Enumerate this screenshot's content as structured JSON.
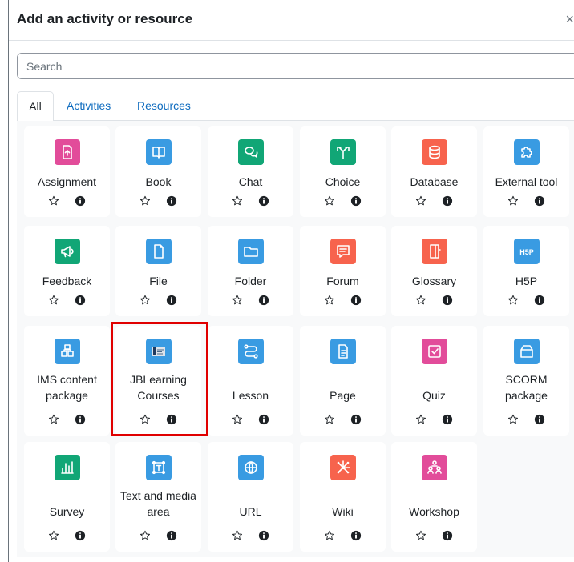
{
  "modal": {
    "title": "Add an activity or resource",
    "close": "×"
  },
  "search": {
    "placeholder": "Search"
  },
  "tabs": [
    "All",
    "Activities",
    "Resources"
  ],
  "colors": {
    "pink": "#e24c9a",
    "blue": "#399be2",
    "green": "#11a676",
    "red": "#f7634d",
    "link": "#0f6cbf",
    "highlight": "#e00000"
  },
  "items": [
    {
      "name": "Assignment",
      "lines": [
        "Assignment"
      ],
      "color": "#e24c9a",
      "icon": "assignment-icon"
    },
    {
      "name": "Book",
      "lines": [
        "Book"
      ],
      "color": "#399be2",
      "icon": "book-icon"
    },
    {
      "name": "Chat",
      "lines": [
        "Chat"
      ],
      "color": "#11a676",
      "icon": "chat-icon"
    },
    {
      "name": "Choice",
      "lines": [
        "Choice"
      ],
      "color": "#11a676",
      "icon": "choice-icon"
    },
    {
      "name": "Database",
      "lines": [
        "Database"
      ],
      "color": "#f7634d",
      "icon": "database-icon"
    },
    {
      "name": "External tool",
      "lines": [
        "External tool"
      ],
      "color": "#399be2",
      "icon": "puzzle-icon"
    },
    {
      "name": "Feedback",
      "lines": [
        "Feedback"
      ],
      "color": "#11a676",
      "icon": "megaphone-icon"
    },
    {
      "name": "File",
      "lines": [
        "File"
      ],
      "color": "#399be2",
      "icon": "file-icon"
    },
    {
      "name": "Folder",
      "lines": [
        "Folder"
      ],
      "color": "#399be2",
      "icon": "folder-icon"
    },
    {
      "name": "Forum",
      "lines": [
        "Forum"
      ],
      "color": "#f7634d",
      "icon": "forum-icon"
    },
    {
      "name": "Glossary",
      "lines": [
        "Glossary"
      ],
      "color": "#f7634d",
      "icon": "glossary-icon"
    },
    {
      "name": "H5P",
      "lines": [
        "H5P"
      ],
      "color": "#399be2",
      "icon": "h5p-icon"
    },
    {
      "name": "IMS content package",
      "lines": [
        "IMS content",
        "package"
      ],
      "color": "#399be2",
      "icon": "ims-package-icon"
    },
    {
      "name": "JBLearning Courses",
      "lines": [
        "JBLearning",
        "Courses"
      ],
      "color": "#399be2",
      "icon": "jblearning-logo-icon"
    },
    {
      "name": "Lesson",
      "lines": [
        "Lesson"
      ],
      "color": "#399be2",
      "icon": "lesson-icon"
    },
    {
      "name": "Page",
      "lines": [
        "Page"
      ],
      "color": "#399be2",
      "icon": "page-icon"
    },
    {
      "name": "Quiz",
      "lines": [
        "Quiz"
      ],
      "color": "#e24c9a",
      "icon": "quiz-icon"
    },
    {
      "name": "SCORM package",
      "lines": [
        "SCORM",
        "package"
      ],
      "color": "#399be2",
      "icon": "scorm-icon"
    },
    {
      "name": "Survey",
      "lines": [
        "Survey"
      ],
      "color": "#11a676",
      "icon": "survey-icon"
    },
    {
      "name": "Text and media area",
      "lines": [
        "Text and media",
        "area"
      ],
      "color": "#399be2",
      "icon": "text-media-icon"
    },
    {
      "name": "URL",
      "lines": [
        "URL"
      ],
      "color": "#399be2",
      "icon": "url-icon"
    },
    {
      "name": "Wiki",
      "lines": [
        "Wiki"
      ],
      "color": "#f7634d",
      "icon": "wiki-icon"
    },
    {
      "name": "Workshop",
      "lines": [
        "Workshop"
      ],
      "color": "#e24c9a",
      "icon": "workshop-icon"
    }
  ]
}
